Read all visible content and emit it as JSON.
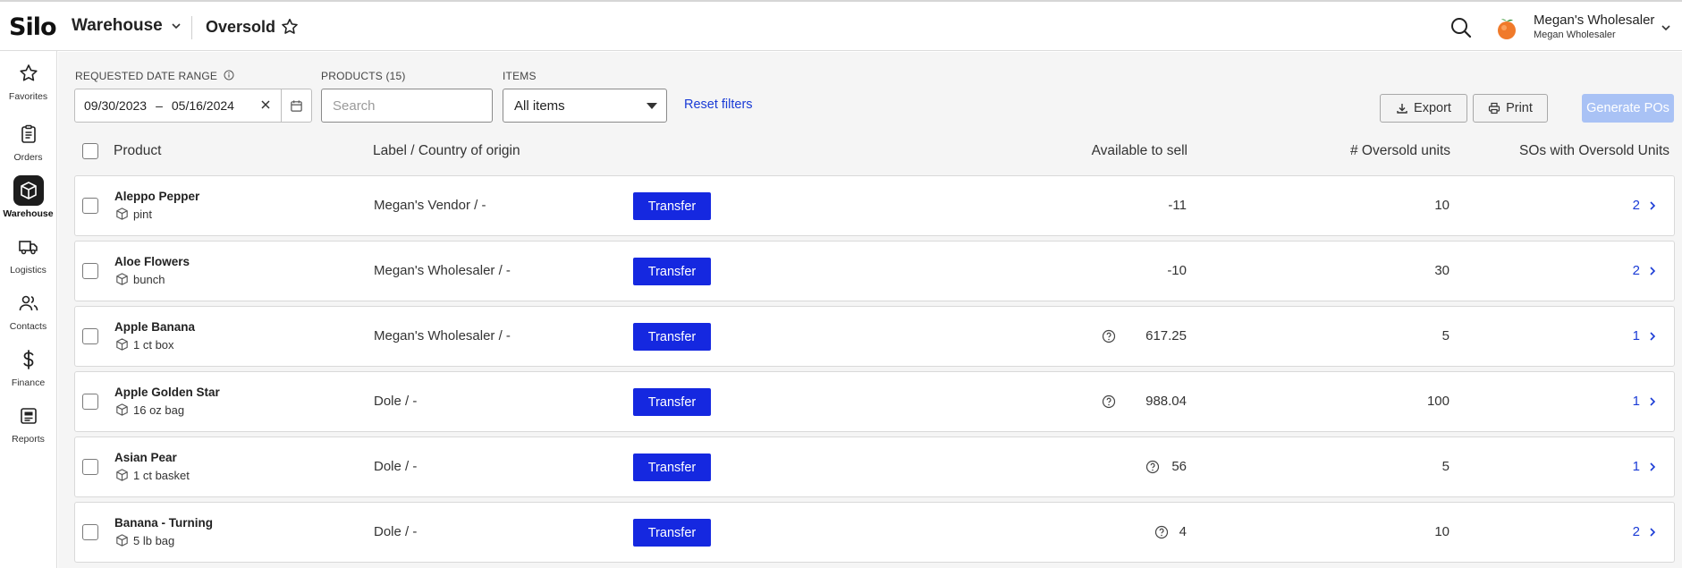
{
  "header": {
    "logo": "Silo",
    "module": "Warehouse",
    "page_title": "Oversold",
    "account_name": "Megan's Wholesaler",
    "account_sub": "Megan Wholesaler"
  },
  "sidebar": {
    "items": [
      {
        "label": "Favorites",
        "icon": "star-icon"
      },
      {
        "label": "Orders",
        "icon": "clipboard-icon"
      },
      {
        "label": "Warehouse",
        "icon": "box-icon",
        "active": true
      },
      {
        "label": "Logistics",
        "icon": "truck-icon"
      },
      {
        "label": "Contacts",
        "icon": "users-icon"
      },
      {
        "label": "Finance",
        "icon": "dollar-icon"
      },
      {
        "label": "Reports",
        "icon": "report-icon"
      }
    ]
  },
  "filters": {
    "date_label": "REQUESTED DATE RANGE",
    "date_from": "09/30/2023",
    "date_sep": "–",
    "date_to": "05/16/2024",
    "products_label": "PRODUCTS (15)",
    "search_placeholder": "Search",
    "items_label": "ITEMS",
    "items_value": "All items",
    "reset_label": "Reset filters"
  },
  "actions": {
    "export": "Export",
    "print": "Print",
    "generate": "Generate POs"
  },
  "table": {
    "columns": {
      "product": "Product",
      "label_origin": "Label / Country of origin",
      "available": "Available to sell",
      "oversold": "# Oversold units",
      "sos": "SOs with Oversold Units"
    },
    "transfer_label": "Transfer",
    "rows": [
      {
        "name": "Aleppo Pepper",
        "pack": "pint",
        "origin": "Megan's Vendor / -",
        "available": "-11",
        "help": false,
        "oversold": "10",
        "sos": "2"
      },
      {
        "name": "Aloe Flowers",
        "pack": "bunch",
        "origin": "Megan's Wholesaler / -",
        "available": "-10",
        "help": false,
        "oversold": "30",
        "sos": "2"
      },
      {
        "name": "Apple Banana",
        "pack": "1 ct box",
        "origin": "Megan's Wholesaler / -",
        "available": "617.25",
        "help": true,
        "oversold": "5",
        "sos": "1"
      },
      {
        "name": "Apple Golden Star",
        "pack": "16 oz bag",
        "origin": "Dole / -",
        "available": "988.04",
        "help": true,
        "oversold": "100",
        "sos": "1"
      },
      {
        "name": "Asian Pear",
        "pack": "1 ct basket",
        "origin": "Dole / -",
        "available": "56",
        "help": true,
        "oversold": "5",
        "sos": "1"
      },
      {
        "name": "Banana - Turning",
        "pack": "5 lb bag",
        "origin": "Dole / -",
        "available": "4",
        "help": true,
        "oversold": "10",
        "sos": "2"
      }
    ]
  },
  "colors": {
    "primary": "#1528e0",
    "link": "#1a3bd6",
    "disabled_primary": "#a9c2f5",
    "background": "#f5f5f5"
  }
}
